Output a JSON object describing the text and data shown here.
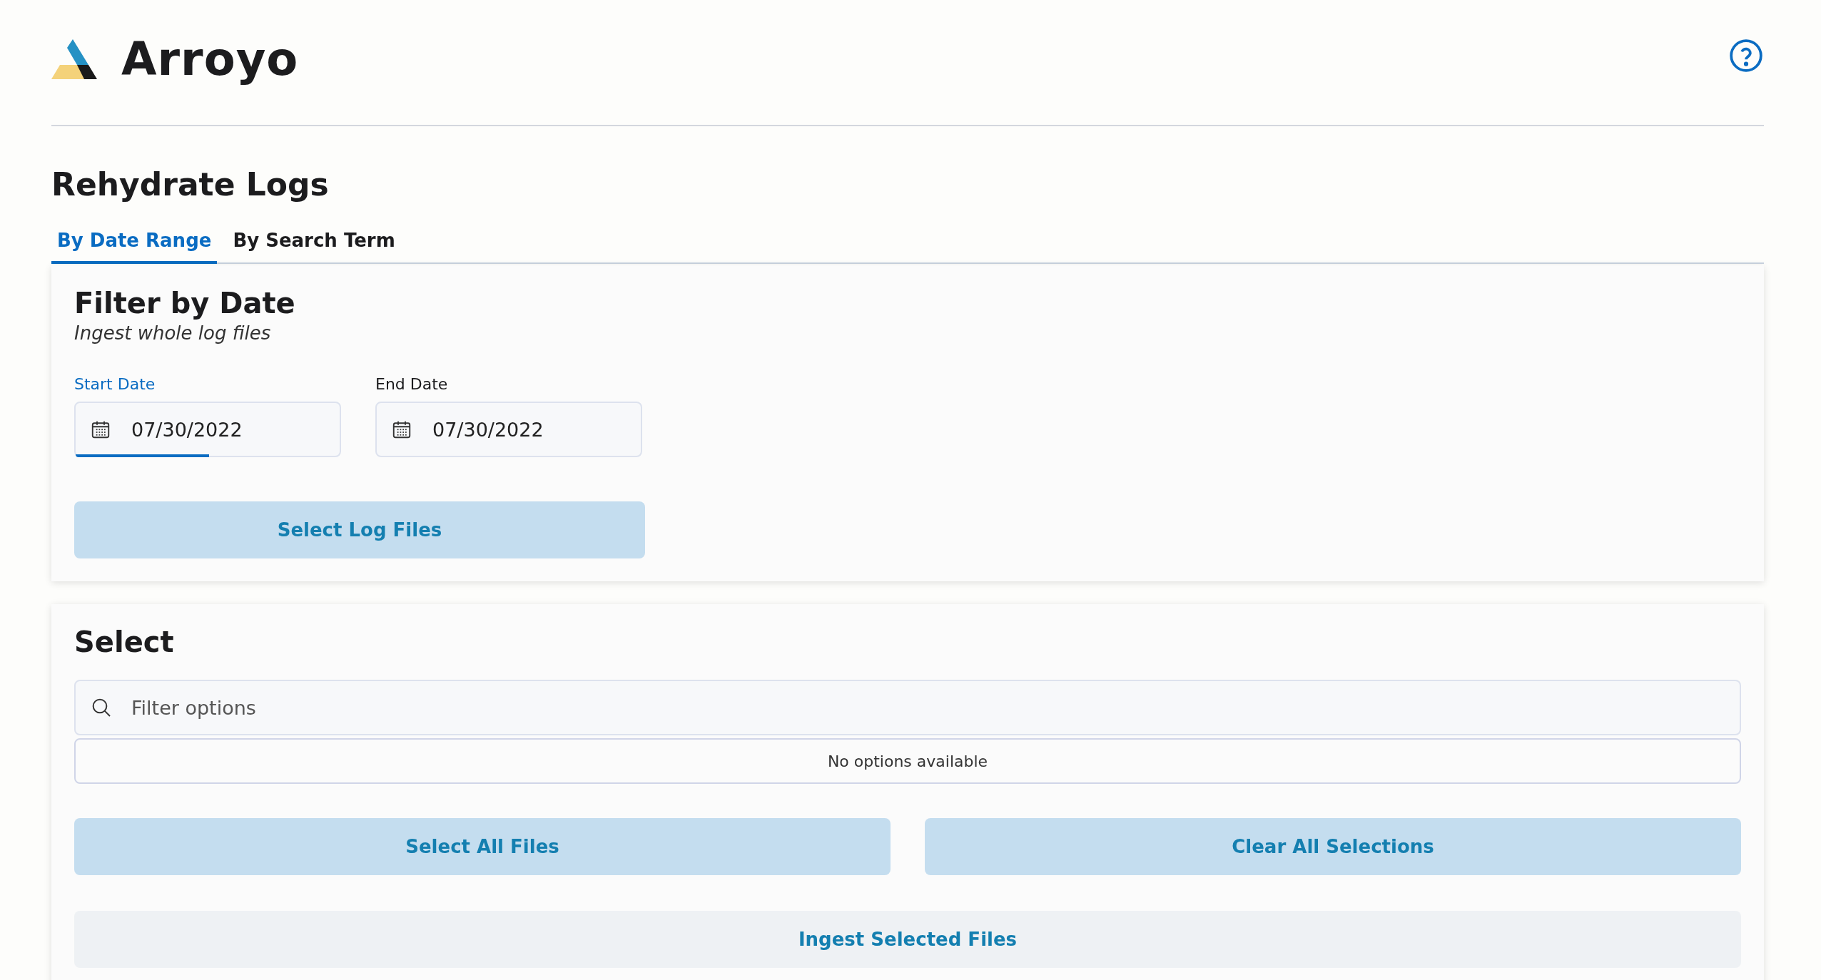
{
  "header": {
    "logo_text": "Arroyo"
  },
  "page_title": "Rehydrate Logs",
  "tabs": [
    {
      "label": "By Date Range",
      "selected": true
    },
    {
      "label": "By Search Term",
      "selected": false
    }
  ],
  "filter_card": {
    "title": "Filter by Date",
    "subtitle": "Ingest whole log files",
    "fields": [
      {
        "label": "Start Date",
        "value": "07/30/2022",
        "focused": true
      },
      {
        "label": "End Date",
        "value": "07/30/2022",
        "focused": false
      }
    ],
    "button": "Select Log Files"
  },
  "select_card": {
    "title": "Select",
    "search": {
      "placeholder": "Filter options"
    },
    "empty_message": "No options available",
    "buttons": [
      {
        "label": "Select All Files",
        "disabled": false
      },
      {
        "label": "Clear All Selections",
        "disabled": false
      }
    ],
    "ingest_button": {
      "label": "Ingest Selected Files",
      "disabled": true
    }
  }
}
